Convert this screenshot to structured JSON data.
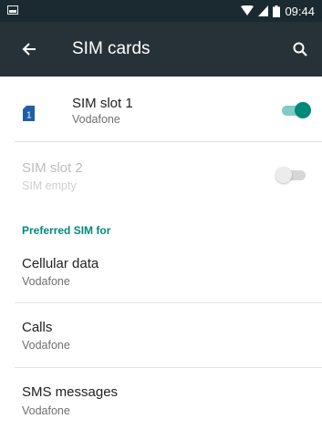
{
  "status_bar": {
    "time": "09:44",
    "icons": [
      "image-icon",
      "wifi-icon",
      "signal-icon",
      "battery-icon"
    ]
  },
  "app_bar": {
    "title": "SIM cards",
    "back_icon": "back-arrow-icon",
    "search_icon": "search-icon",
    "background": "#263238"
  },
  "sim_slots": [
    {
      "title": "SIM slot 1",
      "subtitle": "Vodafone",
      "enabled": true,
      "slot_number": "1"
    },
    {
      "title": "SIM slot 2",
      "subtitle": "SIM empty",
      "enabled": false
    }
  ],
  "preferred_section": {
    "header": "Preferred SIM for",
    "items": [
      {
        "title": "Cellular data",
        "subtitle": "Vodafone"
      },
      {
        "title": "Calls",
        "subtitle": "Vodafone"
      },
      {
        "title": "SMS messages",
        "subtitle": "Vodafone"
      }
    ]
  },
  "colors": {
    "accent": "#00897b",
    "sim_icon": "#1e5fa8",
    "toggle_on_track": "#80cbc4",
    "toggle_off_track": "#d6d6d6",
    "toggle_off_thumb": "#ececec"
  }
}
